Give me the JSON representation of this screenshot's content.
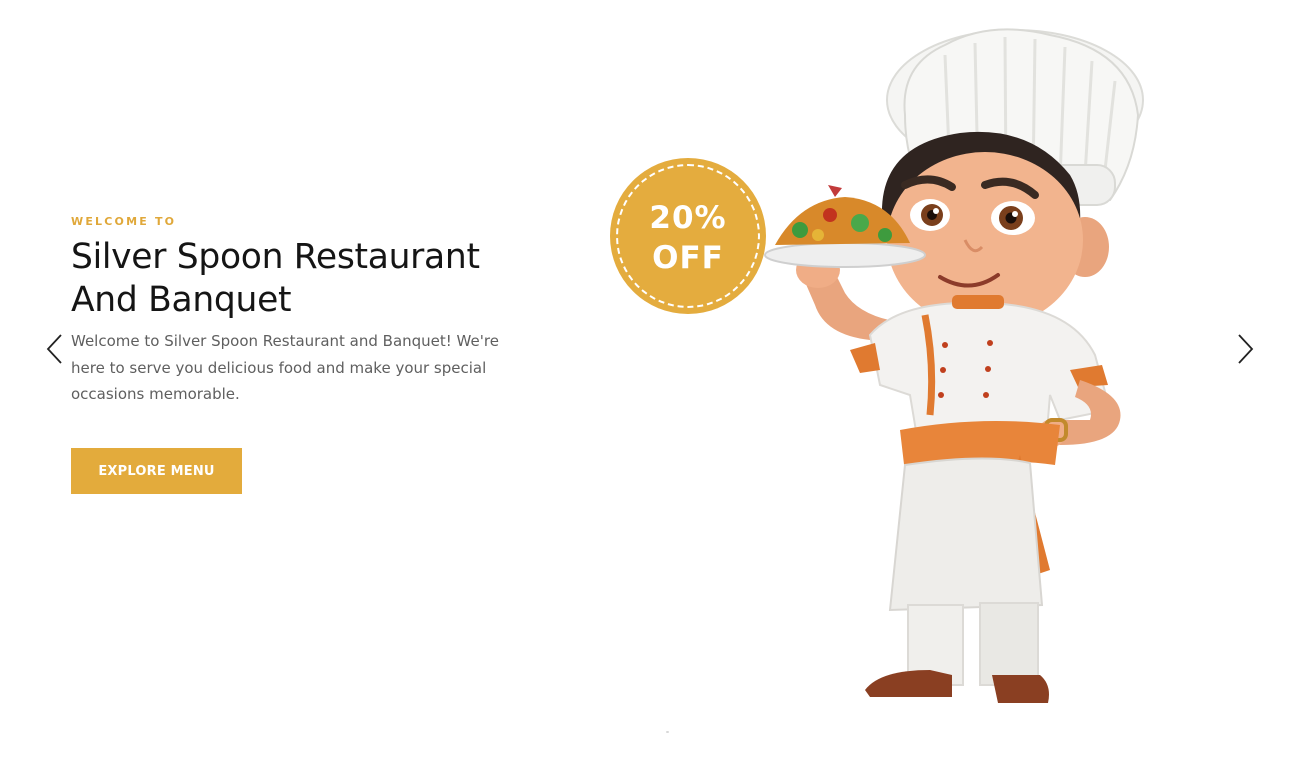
{
  "hero": {
    "eyebrow": "WELCOME TO",
    "title_line1": "Silver Spoon Restaurant",
    "title_line2": "And Banquet",
    "description": "Welcome to Silver Spoon Restaurant and Banquet! We're here to serve you delicious food and make your special occasions memorable.",
    "cta_label": "EXPLORE MENU"
  },
  "badge": {
    "line1": "20%",
    "line2": "OFF"
  },
  "carousel": {
    "prev_icon": "chevron-left-icon",
    "next_icon": "chevron-right-icon"
  },
  "colors": {
    "accent": "#e3ab3c",
    "title": "#151515",
    "body_text": "#5f5f5f",
    "background": "#ffffff"
  }
}
